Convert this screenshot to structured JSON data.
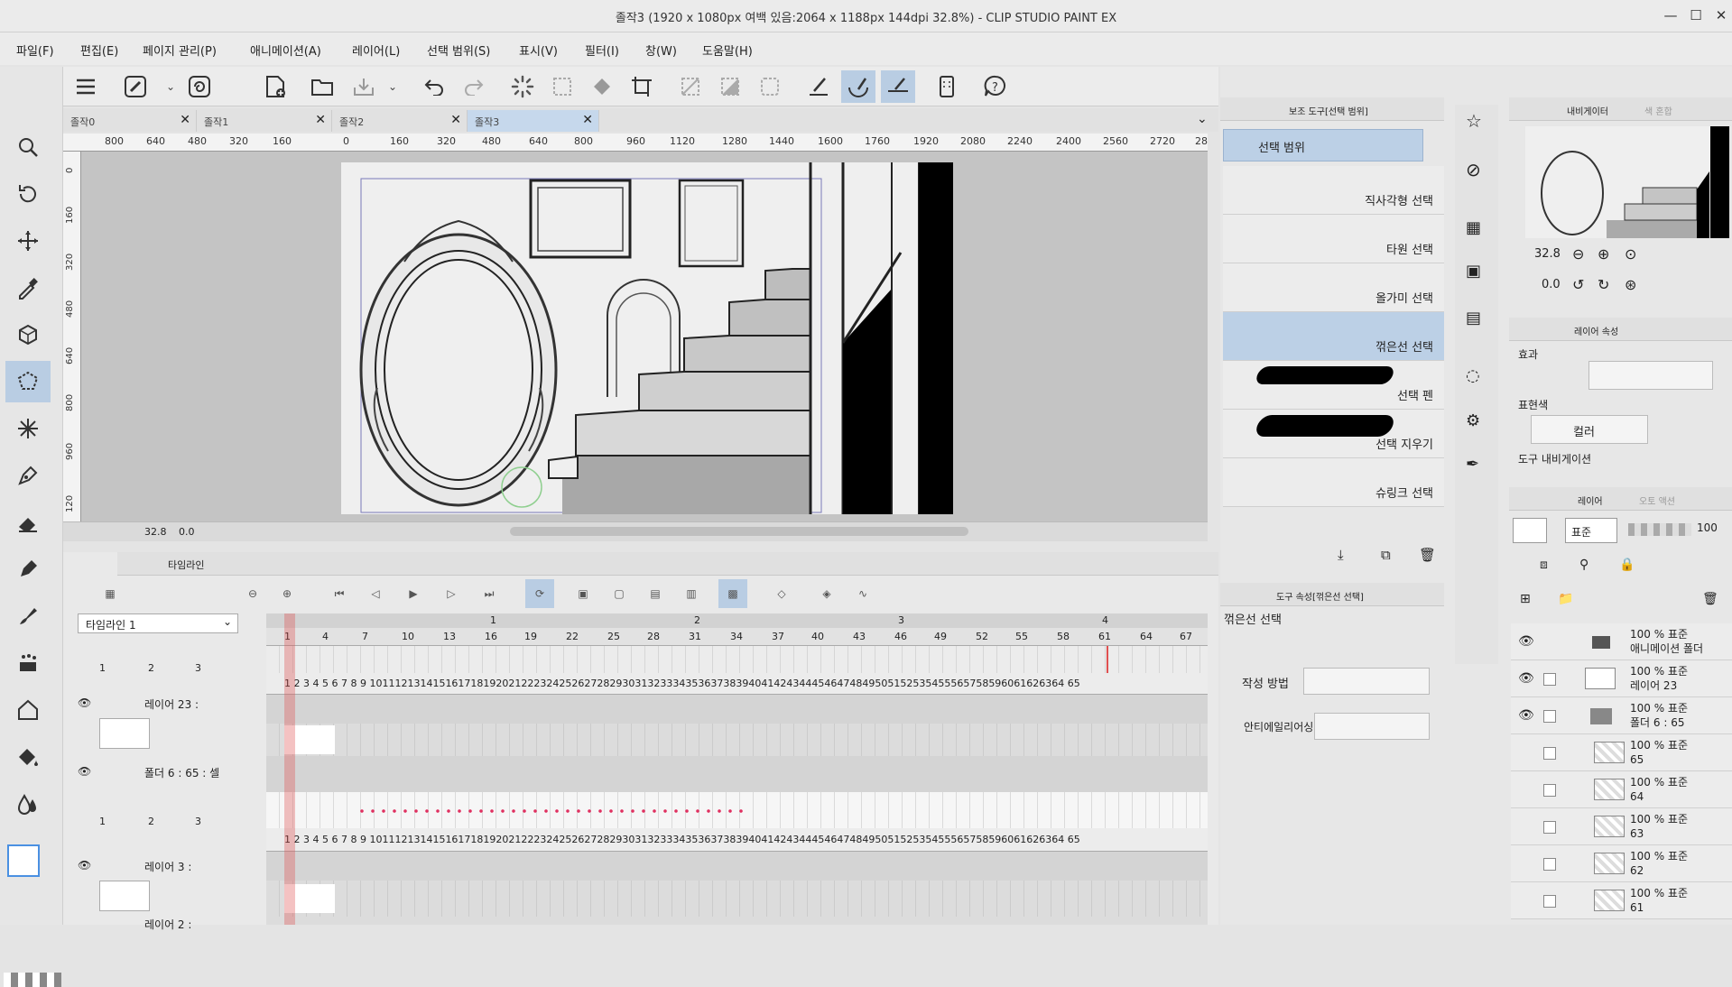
{
  "window": {
    "title": "졸작3 (1920 x 1080px 여백 있음:2064 x 1188px 144dpi 32.8%)  - CLIP STUDIO PAINT EX",
    "minimize": "—",
    "maximize": "☐",
    "close": "✕"
  },
  "menu": [
    "파일(F)",
    "편집(E)",
    "페이지 관리(P)",
    "애니메이션(A)",
    "레이어(L)",
    "선택 범위(S)",
    "표시(V)",
    "필터(I)",
    "창(W)",
    "도움말(H)"
  ],
  "tabs": [
    {
      "label": "졸작0",
      "close": "✕"
    },
    {
      "label": "졸작1",
      "close": "✕"
    },
    {
      "label": "졸작2",
      "close": "✕"
    },
    {
      "label": "졸작3",
      "close": "✕",
      "active": true
    }
  ],
  "ruler": {
    "h": [
      "800",
      "640",
      "480",
      "320",
      "160",
      "0",
      "160",
      "320",
      "480",
      "640",
      "800",
      "960",
      "1120",
      "1280",
      "1440",
      "1600",
      "1760",
      "1920",
      "2080",
      "2240",
      "2400",
      "2560",
      "2720",
      "28"
    ],
    "v": [
      "0",
      "160",
      "320",
      "480",
      "640",
      "800",
      "960",
      "120"
    ]
  },
  "status": {
    "zoom": "32.8",
    "rotation": "0.0"
  },
  "timeline": {
    "panel_title": "타임라인",
    "selector": "타임라인 1",
    "second_marks": [
      "1",
      "2",
      "3",
      "4"
    ],
    "frame_marks": [
      "1",
      "4",
      "7",
      "10",
      "13",
      "16",
      "19",
      "22",
      "25",
      "28",
      "31",
      "34",
      "37",
      "40",
      "43",
      "46",
      "49",
      "52",
      "55",
      "58",
      "61",
      "64",
      "67"
    ],
    "cel_labels": [
      "1",
      "2",
      "3"
    ],
    "frame_sequence": "1 2 3 4 5 6 7 8 9 10111213141516171819202122232425262728293031323334353637383940414243444546474849505152535455565758596061626364 65",
    "tracks": [
      {
        "name": "레이어 23 :"
      },
      {
        "name": "폴더 6 : 65 : 셀"
      },
      {
        "name": "레이어 3 :"
      },
      {
        "name": "레이어 2 :"
      }
    ]
  },
  "subtool": {
    "panel_title": "보조 도구[선택 범위]",
    "group": "선택 범위",
    "items": [
      {
        "label": "직사각형 선택"
      },
      {
        "label": "타원 선택"
      },
      {
        "label": "올가미 선택"
      },
      {
        "label": "꺾은선 선택",
        "active": true
      },
      {
        "label": "선택 펜"
      },
      {
        "label": "선택 지우기"
      },
      {
        "label": "슈링크 선택"
      }
    ]
  },
  "tool_property": {
    "panel_title": "도구 속성[꺾은선 선택]",
    "tool_name": "꺾은선 선택",
    "creation_label": "작성 방법",
    "antialias_label": "안티에일리어싱"
  },
  "navigator": {
    "panel_title": "내비게이터",
    "tab2": "색 혼합",
    "zoom": "32.8",
    "angle": "0.0"
  },
  "layer_property": {
    "panel_title": "레이어 속성",
    "effect_label": "효과",
    "color_label": "표현색",
    "color_value": "컬러",
    "tool_nav_label": "도구 내비게이션"
  },
  "layers": {
    "panel_title": "레이어",
    "tab2": "오토 액션",
    "blend": "표준",
    "opacity": "100",
    "rows": [
      {
        "line1": "100 % 표준",
        "line2": "애니메이션 폴더"
      },
      {
        "line1": "100 % 표준",
        "line2": "레이어 23"
      },
      {
        "line1": "100 % 표준",
        "line2": "폴더 6 : 65"
      },
      {
        "line1": "100 % 표준",
        "line2": "65"
      },
      {
        "line1": "100 % 표준",
        "line2": "64"
      },
      {
        "line1": "100 % 표준",
        "line2": "63"
      },
      {
        "line1": "100 % 표준",
        "line2": "62"
      },
      {
        "line1": "100 % 표준",
        "line2": "61"
      }
    ]
  },
  "colors": {
    "accent_selected": "#b9cde3",
    "playhead": "#e05050",
    "panel_bg": "#e7e7e7"
  }
}
